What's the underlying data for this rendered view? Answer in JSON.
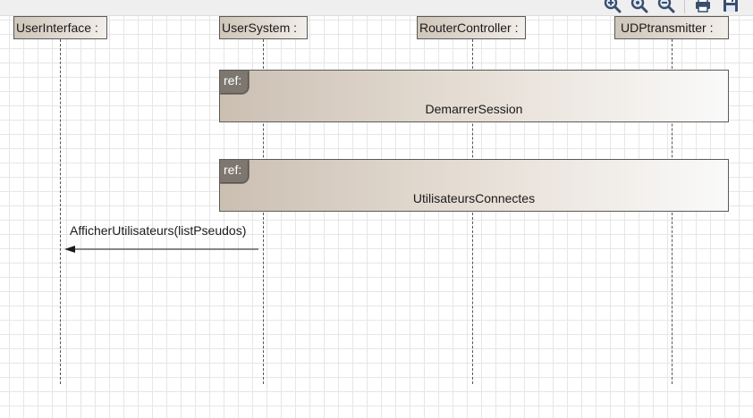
{
  "lifelines": [
    {
      "label": "UserInterface :"
    },
    {
      "label": "UserSystem :"
    },
    {
      "label": "RouterController :"
    },
    {
      "label": "UDPtransmitter :"
    }
  ],
  "fragments": [
    {
      "tag": "ref:",
      "name": "DemarrerSession"
    },
    {
      "tag": "ref:",
      "name": "UtilisateursConnectes"
    }
  ],
  "message": {
    "label": "AfficherUtilisateurs(listPseudos)"
  },
  "toolbar": {
    "icons": [
      "zoom-in-icon",
      "zoom-reset-icon",
      "zoom-out-icon",
      "print-icon",
      "save-icon"
    ]
  },
  "colors": {
    "head_start": "#cfc5b8",
    "head_end": "#f2eee9",
    "ref_tag": "#7d7770",
    "grid": "#e6e6e6"
  }
}
